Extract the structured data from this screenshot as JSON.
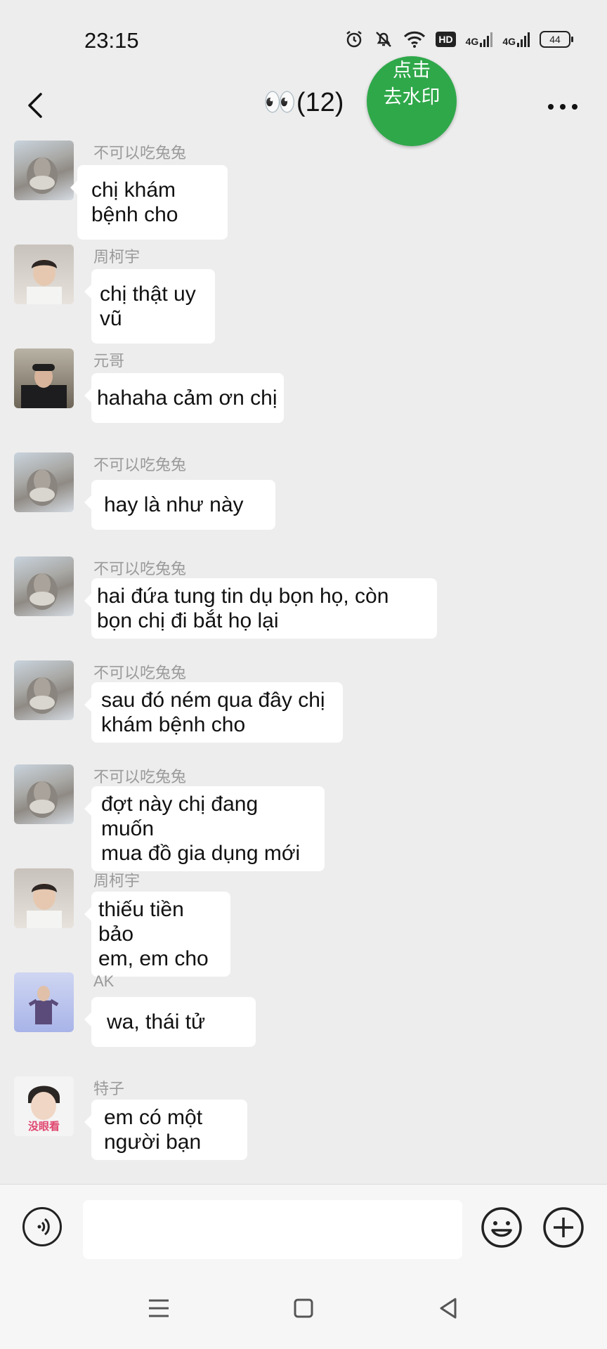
{
  "status_bar": {
    "time": "23:15",
    "battery": "44",
    "network": "4G",
    "hd": "HD"
  },
  "header": {
    "title": "👀(12)",
    "watermark_line1": "点击",
    "watermark_line2": "去水印"
  },
  "messages": [
    {
      "sender": "不可以吃兔兔",
      "text": "chị khám bệnh cho",
      "avatar": "cat"
    },
    {
      "sender": "周柯宇",
      "text": "chị thật uy vũ",
      "avatar": "person-white-shirt"
    },
    {
      "sender": "元哥",
      "text": "hahaha cảm ơn chị",
      "avatar": "person-cap"
    },
    {
      "sender": "不可以吃兔兔",
      "text": "hay là như này",
      "avatar": "cat"
    },
    {
      "sender": "不可以吃兔兔",
      "text": "hai đứa tung tin dụ bọn họ, còn\nbọn chị đi bắt họ lại",
      "avatar": "cat"
    },
    {
      "sender": "不可以吃兔兔",
      "text": "sau đó ném qua đây chị\nkhám bệnh cho",
      "avatar": "cat"
    },
    {
      "sender": "不可以吃兔兔",
      "text": "đợt này chị đang muốn\nmua đồ gia dụng mới",
      "avatar": "cat"
    },
    {
      "sender": "周柯宇",
      "text": "thiếu tiền bảo\nem, em cho",
      "avatar": "person-white-shirt"
    },
    {
      "sender": "AK",
      "text": "wa, thái tử",
      "avatar": "person-stage"
    },
    {
      "sender": "特子",
      "text": "em có một\nngười bạn",
      "avatar": "person-sticker",
      "avatar_caption": "没眼看"
    }
  ],
  "input": {
    "placeholder": ""
  },
  "colors": {
    "background": "#ededed",
    "bubble": "#ffffff",
    "accent_green": "#2fa84a",
    "sender_gray": "#9a9a9a"
  },
  "icons": [
    "back-arrow-icon",
    "more-dots-icon",
    "voice-icon",
    "emoji-icon",
    "plus-icon",
    "menu-icon",
    "home-icon",
    "back-triangle-icon"
  ]
}
